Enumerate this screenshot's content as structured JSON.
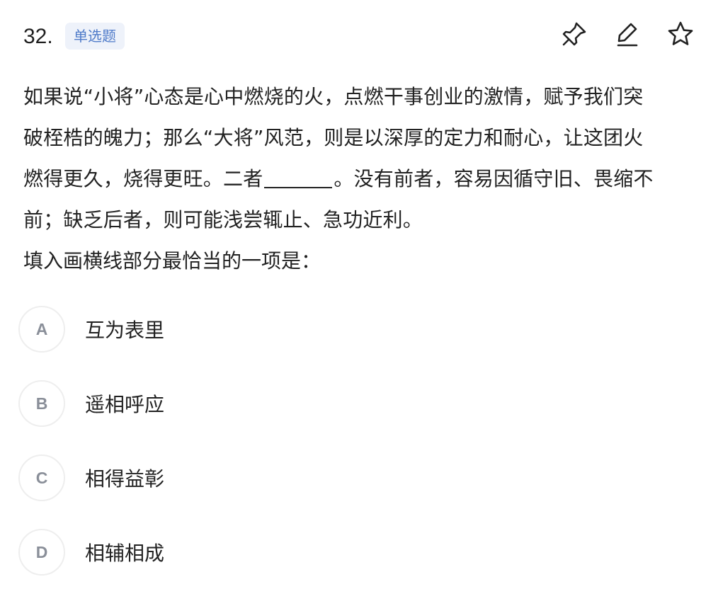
{
  "header": {
    "question_number": "32.",
    "type_badge": "单选题",
    "icons": [
      "pin-icon",
      "edit-icon",
      "star-icon"
    ]
  },
  "question": {
    "line1": "如果说“小将”心态是心中燃烧的火，点燃干事创业的激情，赋予我们突",
    "line2": "破桎梏的魄力；那么“大将”风范，则是以深厚的定力和耐心，让这团火",
    "line3_before_blank": "燃得更久，烧得更旺。二者",
    "line3_after_blank": "。没有前者，容易因循守旧、畏缩不",
    "line4": "前；缺乏后者，则可能浅尝辄止、急功近利。",
    "prompt": "填入画横线部分最恰当的一项是："
  },
  "options": [
    {
      "letter": "A",
      "text": "互为表里"
    },
    {
      "letter": "B",
      "text": "遥相呼应"
    },
    {
      "letter": "C",
      "text": "相得益彰"
    },
    {
      "letter": "D",
      "text": "相辅相成"
    }
  ],
  "colors": {
    "badge_bg": "#eef2fa",
    "badge_text": "#4f7bc9",
    "option_letter": "#8a8f99",
    "text": "#222222"
  }
}
